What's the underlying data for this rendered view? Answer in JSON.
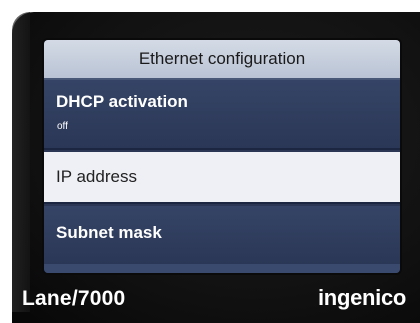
{
  "screen": {
    "header": "Ethernet configuration",
    "items": [
      {
        "label": "DHCP activation",
        "value": "off",
        "selected": false
      },
      {
        "label": "IP address",
        "selected": true
      },
      {
        "label": "Subnet mask",
        "selected": false
      }
    ]
  },
  "device": {
    "model": "Lane/7000",
    "brand": "ingenico"
  },
  "colors": {
    "screen_bg": "#2a3654",
    "header_bg": "#c9d1de",
    "selected_bg": "#eef0f5",
    "device_body": "#111111"
  }
}
